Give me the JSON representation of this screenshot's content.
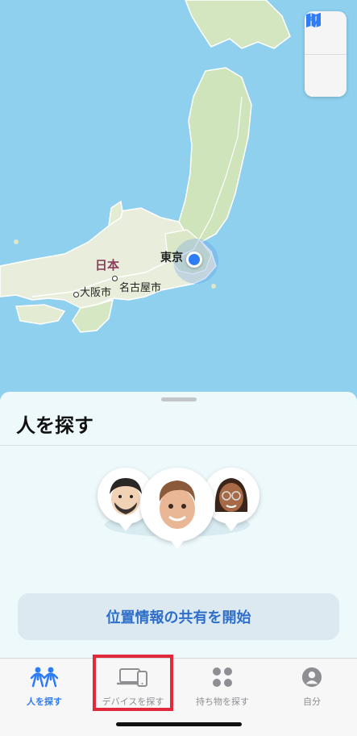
{
  "map": {
    "country_label": "日本",
    "cities": {
      "tokyo": "東京",
      "osaka": "大阪市",
      "nagoya": "名古屋市"
    },
    "colors": {
      "water": "#8ed0ee",
      "land": "#e9f0d9",
      "land_green": "#c9e2b4",
      "location": "#2f7df6"
    }
  },
  "map_controls": {
    "map_icon": "map-icon",
    "location_icon": "location-arrow-icon"
  },
  "sheet": {
    "title": "人を探す",
    "share_button_label": "位置情報の共有を開始"
  },
  "tabs": [
    {
      "label": "人を探す",
      "icon": "people-icon",
      "active": true
    },
    {
      "label": "デバイスを探す",
      "icon": "devices-icon",
      "active": false
    },
    {
      "label": "持ち物を探す",
      "icon": "items-grid-icon",
      "active": false
    },
    {
      "label": "自分",
      "icon": "person-circle-icon",
      "active": false
    }
  ],
  "accent_color": "#2f7df6",
  "highlight_color": "#e02a3b"
}
